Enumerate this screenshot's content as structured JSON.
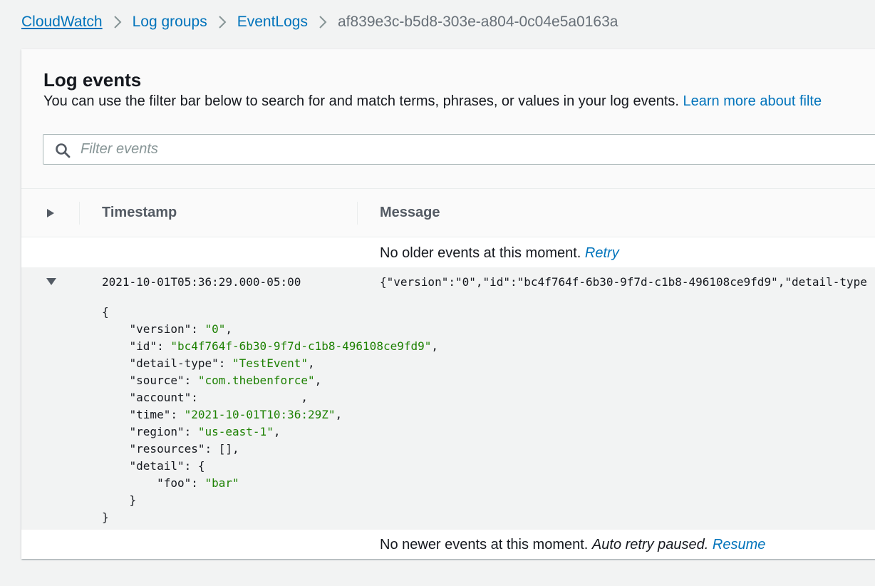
{
  "breadcrumb": {
    "items": [
      "CloudWatch",
      "Log groups",
      "EventLogs"
    ],
    "current": "af839e3c-b5d8-303e-a804-0c04e5a0163a"
  },
  "panel": {
    "title": "Log events",
    "description": "You can use the filter bar below to search for and match terms, phrases, or values in your log events. ",
    "learn_more": "Learn more about filte"
  },
  "filter": {
    "placeholder": "Filter events",
    "value": ""
  },
  "table": {
    "columns": {
      "timestamp": "Timestamp",
      "message": "Message"
    },
    "older": {
      "text": "No older events at this moment. ",
      "link": "Retry"
    },
    "event": {
      "timestamp": "2021-10-01T05:36:29.000-05:00",
      "message": "{\"version\":\"0\",\"id\":\"bc4f764f-6b30-9f7d-c1b8-496108ce9fd9\",\"detail-type",
      "json": {
        "open": "{",
        "version_key": "\"version\"",
        "version_val": "\"0\"",
        "id_key": "\"id\"",
        "id_val": "\"bc4f764f-6b30-9f7d-c1b8-496108ce9fd9\"",
        "detail_type_key": "\"detail-type\"",
        "detail_type_val": "\"TestEvent\"",
        "source_key": "\"source\"",
        "source_val": "\"com.thebenforce\"",
        "account_key": "\"account\"",
        "account_val": "",
        "time_key": "\"time\"",
        "time_val": "\"2021-10-01T10:36:29Z\"",
        "region_key": "\"region\"",
        "region_val": "\"us-east-1\"",
        "resources_key": "\"resources\"",
        "resources_val": "[]",
        "detail_key": "\"detail\"",
        "detail_open": "{",
        "foo_key": "\"foo\"",
        "foo_val": "\"bar\"",
        "detail_close": "}",
        "close": "}"
      }
    },
    "newer": {
      "text": "No newer events at this moment. ",
      "italic": "Auto retry paused.",
      "link": "Resume"
    }
  },
  "colors": {
    "link": "#0073bb",
    "json_string": "#1d8102",
    "page_background": "#f2f3f3"
  },
  "icons": [
    "chevron-right-icon",
    "search-icon",
    "caret-right-icon",
    "caret-down-icon"
  ]
}
